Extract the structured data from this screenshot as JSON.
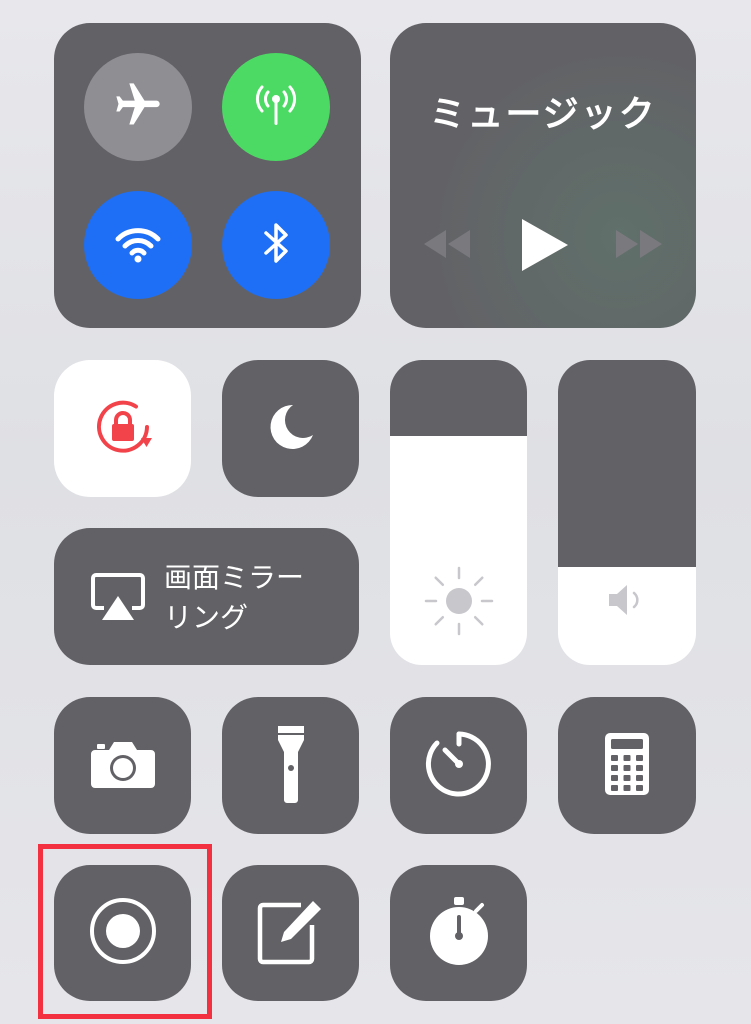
{
  "connectivity": {
    "airplane_mode": {
      "state": "off",
      "color": "#8e8e93"
    },
    "cellular_data": {
      "state": "on",
      "color": "#4cd964"
    },
    "wifi": {
      "state": "on",
      "color": "#1e6ff5"
    },
    "bluetooth": {
      "state": "on",
      "color": "#1e6ff5"
    }
  },
  "music": {
    "title": "ミュージック",
    "controls": [
      "previous-track",
      "play",
      "next-track"
    ]
  },
  "toggles": {
    "orientation_lock": {
      "state": "on",
      "color": "#f2434b"
    },
    "do_not_disturb": {
      "state": "off"
    }
  },
  "screen_mirroring": {
    "label_line1": "画面ミラー",
    "label_line2": "リング"
  },
  "brightness": {
    "level_percent": 75
  },
  "volume": {
    "level_percent": 32
  },
  "shortcuts": [
    "camera",
    "flashlight",
    "timer",
    "calculator",
    "screen-recording",
    "notes",
    "stopwatch"
  ],
  "highlighted_control": "screen-recording",
  "colors": {
    "tile": "#626266",
    "highlight": "#f23040"
  }
}
